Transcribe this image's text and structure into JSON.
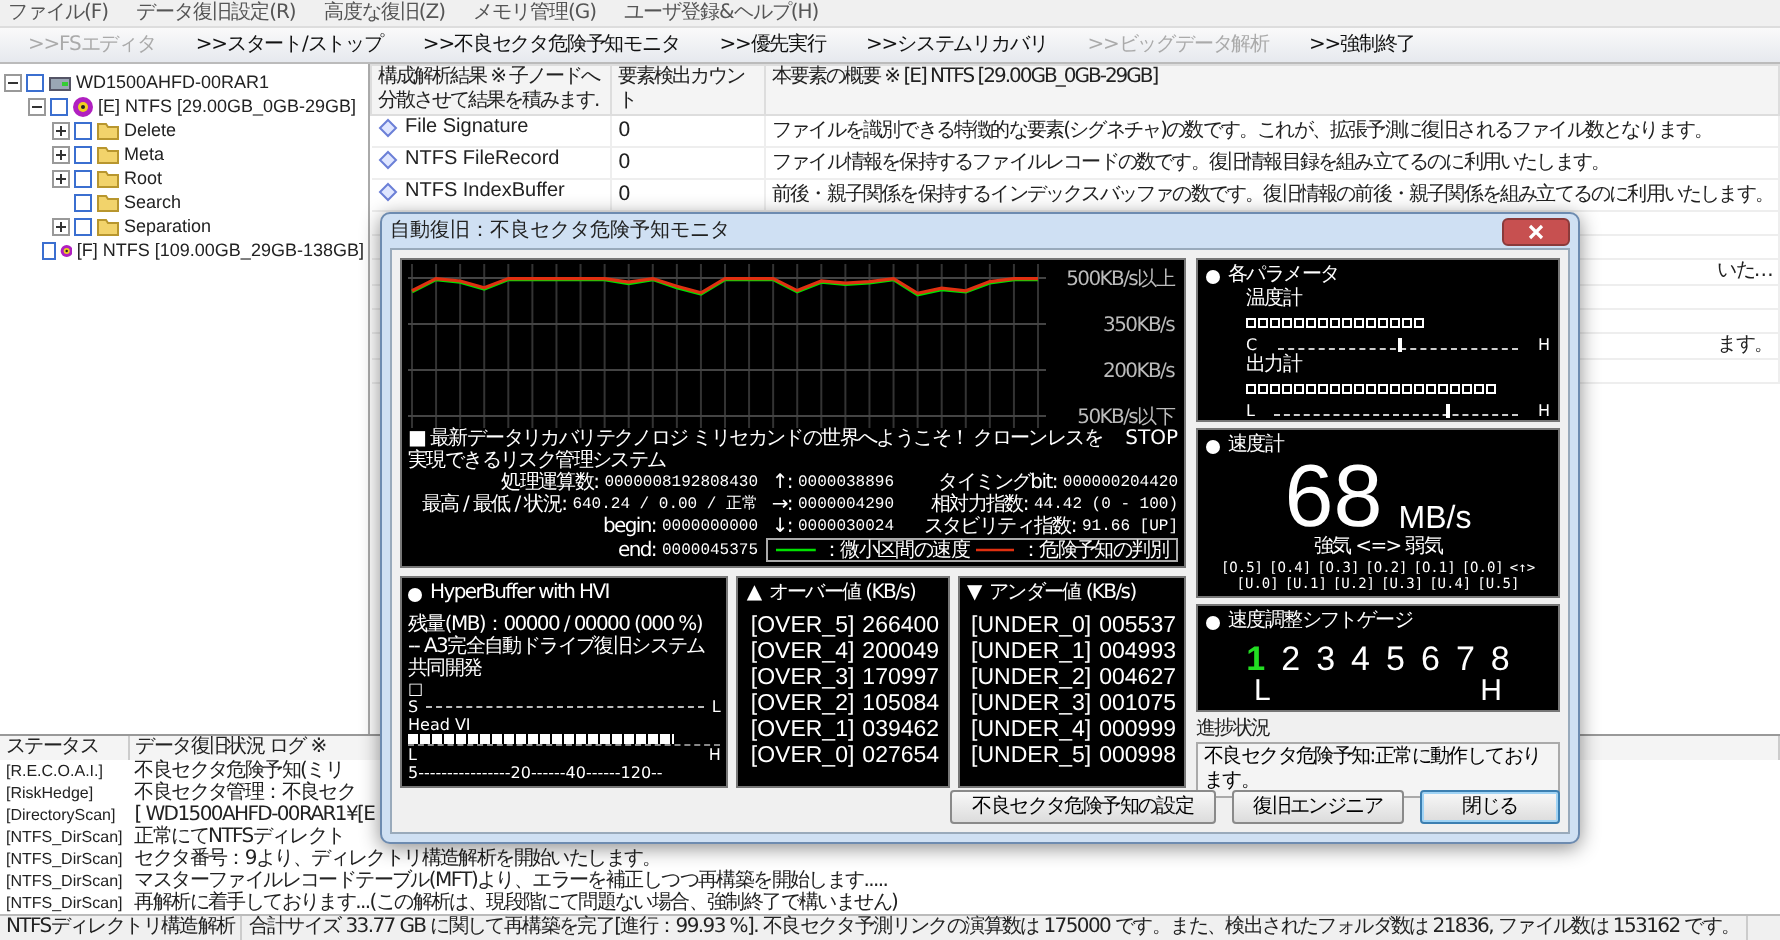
{
  "menu": [
    "ファイル(F)",
    "データ復旧設定(R)",
    "高度な復旧(Z)",
    "メモリ管理(G)",
    "ユーザ登録&ヘルプ(H)"
  ],
  "toolbar": [
    {
      "label": ">>FSエディタ",
      "disabled": true
    },
    {
      "label": ">>スタート/ストップ",
      "disabled": false
    },
    {
      "label": ">>不良セクタ危険予知モニタ",
      "disabled": false
    },
    {
      "label": ">>優先実行",
      "disabled": false
    },
    {
      "label": ">>システムリカバリ",
      "disabled": false
    },
    {
      "label": ">>ビッグデータ解析",
      "disabled": true
    },
    {
      "label": ">>強制終了",
      "disabled": false
    }
  ],
  "tree": [
    {
      "label": "WD1500AHFD-00RAR1",
      "kind": "drive",
      "checked": false,
      "expanded": true,
      "children": [
        {
          "label": "[E] NTFS [29.00GB_0GB-29GB]",
          "kind": "partition",
          "checked": false,
          "expanded": true,
          "children": [
            {
              "label": "Delete",
              "kind": "folder",
              "checked": false,
              "expanded": false
            },
            {
              "label": "Meta",
              "kind": "folder",
              "checked": false,
              "expanded": false
            },
            {
              "label": "Root",
              "kind": "folder",
              "checked": false,
              "expanded": false
            },
            {
              "label": "Search",
              "kind": "folder",
              "checked": false
            },
            {
              "label": "Separation",
              "kind": "folder",
              "checked": false,
              "expanded": false
            }
          ]
        },
        {
          "label": "[F] NTFS [109.00GB_29GB-138GB]",
          "kind": "partition",
          "checked": false
        }
      ]
    }
  ],
  "results_table": {
    "columns": [
      "構成解析結果 ※ 子ノードへ分散させて結果を積みます.",
      "要素検出カウント",
      "本要素の概要 ※ [E] NTFS [29.00GB_0GB-29GB]"
    ],
    "rows": [
      {
        "name": "File Signature",
        "count": "0",
        "description": "ファイルを識別できる特徴的な要素(シグネチャ)の数です。これが、拡張予測に復旧されるファイル数となります。"
      },
      {
        "name": "NTFS FileRecord",
        "count": "0",
        "description": "ファイル情報を保持するファイルレコードの数です。復旧情報目録を組み立てるのに利用いたします。"
      },
      {
        "name": "NTFS IndexBuffer",
        "count": "0",
        "description": "前後・親子関係を保持するインデックスバッファの数です。復旧情報の前後・親子関係を組み立てるのに利用いたします。"
      }
    ],
    "covered_row_ends": [
      "いた…",
      "ます。"
    ]
  },
  "log": {
    "columns": [
      "ステータス",
      "データ復旧状況 ログ ※"
    ],
    "rows": [
      {
        "status": "[R.E.C.O.A.I.]",
        "message": "不良セクタ危険予知(ミリ"
      },
      {
        "status": "[RiskHedge]",
        "message": "不良セクタ管理：不良セク"
      },
      {
        "status": "[DirectoryScan]",
        "message": "[ WD1500AHFD-00RAR1¥[E"
      },
      {
        "status": "[NTFS_DirScan]",
        "message": "正常にてNTFSディレクト"
      },
      {
        "status": "[NTFS_DirScan]",
        "message": "セクタ番号：9より、ディレクトリ構造解析を開始いたします。"
      },
      {
        "status": "[NTFS_DirScan]",
        "message": "マスターファイルレコードテーブル(MFT)より、エラーを補正しつつ再構築を開始します....."
      },
      {
        "status": "[NTFS_DirScan]",
        "message": "再解析に着手しております...(この解析は、現段階にて問題ない場合、強制終了で構いません)"
      }
    ]
  },
  "status_bar": [
    "NTFSディレクトリ構造解析",
    "合計サイズ 33.77 GB に関して再構築を完了[進行：99.93 %]. 不良セクタ予測リンクの演算数は 175000 です。また、検出されたフォルダ数は 21836, ファイル数は 153162 です。"
  ],
  "dialog": {
    "title": "自動復旧：不良セクタ危険予知モニタ",
    "graph": {
      "chart_data": {
        "type": "line",
        "grid": true,
        "ylim": [
          50,
          500
        ],
        "yticks": [
          {
            "value": 500,
            "label": "500KB/s以上"
          },
          {
            "value": 350,
            "label": "350KB/s"
          },
          {
            "value": 200,
            "label": "200KB/s"
          },
          {
            "value": 50,
            "label": "50KB/s以下"
          }
        ],
        "series": [
          {
            "name": "：微小区間の速度",
            "color": "#00e000",
            "values": [
              455,
              495,
              486,
              464,
              495,
              495,
              495,
              495,
              495,
              482,
              495,
              469,
              448,
              495,
              495,
              495,
              455,
              486,
              479,
              484,
              495,
              445,
              462,
              455,
              484,
              495,
              495
            ]
          },
          {
            "name": "：危険予知の判別",
            "color": "#e03010",
            "values": [
              458,
              498,
              490,
              468,
              498,
              498,
              498,
              498,
              498,
              486,
              498,
              473,
              452,
              498,
              498,
              498,
              459,
              490,
              483,
              488,
              498,
              450,
              467,
              458,
              488,
              498,
              498
            ]
          }
        ]
      },
      "headline": "■ 最新データリカバリテクノロジ ミリセカンドの世界へようこそ！ クローンレスを実現できるリスク管理システム",
      "state": "STOP",
      "stats": [
        {
          "label": "処理運算数:",
          "value": "0000008192808430"
        },
        {
          "label": "↑:",
          "value": "0000038896"
        },
        {
          "label": "タイミングbit:",
          "value": "000000204420"
        },
        {
          "label": "最高 / 最低 / 状況:",
          "value": "640.24 / 0.00 / 正常"
        },
        {
          "label": "→:",
          "value": "0000004290"
        },
        {
          "label": "相対力指数:",
          "value": "44.42 (0 - 100)"
        },
        {
          "label": "begin:",
          "value": "0000000000"
        },
        {
          "label": "↓:",
          "value": "0000030024"
        },
        {
          "label": "スタビリティ指数:",
          "value": "91.66 [UP]"
        },
        {
          "label": "end:",
          "value": "0000045375"
        }
      ]
    },
    "hyperbuffer": {
      "title": "HyperBuffer with HVI",
      "remaining": "残量(MB)：00000 / 00000 (000 %)",
      "note": "-- A3完全自動ドライブ復旧システム共同開発",
      "box": "□",
      "scale_low": "S",
      "scale_high": "L",
      "head": {
        "label": "Head VI",
        "level": 0.85,
        "low": "L",
        "high": "H",
        "scale": "5----------------20------40------120--"
      }
    },
    "over": {
      "marker": "▲",
      "title": "オーバー値 (KB/s)",
      "rows": [
        {
          "label": "[OVER_5]",
          "value": "266400"
        },
        {
          "label": "[OVER_4]",
          "value": "200049"
        },
        {
          "label": "[OVER_3]",
          "value": "170997"
        },
        {
          "label": "[OVER_2]",
          "value": "105084"
        },
        {
          "label": "[OVER_1]",
          "value": "039462"
        },
        {
          "label": "[OVER_0]",
          "value": "027654"
        }
      ]
    },
    "under": {
      "marker": "▼",
      "title": "アンダー値 (KB/s)",
      "rows": [
        {
          "label": "[UNDER_0]",
          "value": "005537"
        },
        {
          "label": "[UNDER_1]",
          "value": "004993"
        },
        {
          "label": "[UNDER_2]",
          "value": "004627"
        },
        {
          "label": "[UNDER_3]",
          "value": "001075"
        },
        {
          "label": "[UNDER_4]",
          "value": "000999"
        },
        {
          "label": "[UNDER_5]",
          "value": "000998"
        }
      ]
    },
    "parameters": {
      "title": "各パラメータ",
      "meters": [
        {
          "label": "温度計",
          "level": 0.5,
          "low": "C",
          "high": "H"
        },
        {
          "label": "出力計",
          "level": 0.7,
          "low": "L",
          "high": "H"
        }
      ]
    },
    "speed": {
      "title": "速度計",
      "value": "68",
      "unit": "MB/s",
      "caption": "強気 <=> 弱気",
      "scale": [
        "[O.5]",
        "[O.4]",
        "[O.3]",
        "[O.2]",
        "[O.1]",
        "[O.0]",
        "<↑>",
        "[U.0]",
        "[U.1]",
        "[U.2]",
        "[U.3]",
        "[U.4]",
        "[U.5]"
      ]
    },
    "shift": {
      "title": "速度調整シフトゲージ",
      "gears": [
        {
          "label": "1",
          "selected": true
        },
        {
          "label": "2",
          "selected": false
        },
        {
          "label": "3",
          "selected": false
        },
        {
          "label": "4",
          "selected": false
        },
        {
          "label": "5",
          "selected": false
        },
        {
          "label": "6",
          "selected": false
        },
        {
          "label": "7",
          "selected": false
        },
        {
          "label": "8",
          "selected": false
        }
      ],
      "low": "L",
      "high": "H"
    },
    "progress": {
      "label": "進捗状況",
      "text": "不良セクタ危険予知:正常に動作しております。"
    },
    "buttons": [
      {
        "label": "不良セクタ危険予知の設定",
        "default": false
      },
      {
        "label": "復旧エンジニア",
        "default": false
      },
      {
        "label": "閉じる",
        "default": true
      }
    ]
  }
}
